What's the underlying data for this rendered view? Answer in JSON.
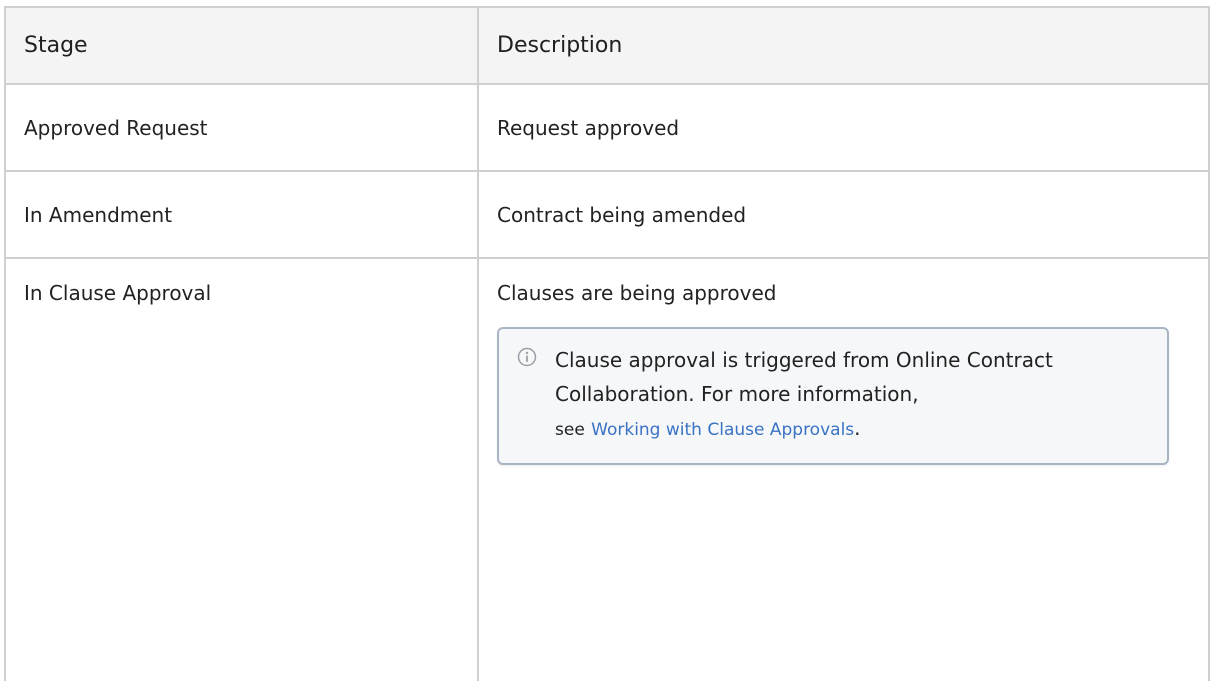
{
  "table": {
    "headers": {
      "stage": "Stage",
      "description": "Description"
    },
    "rows": [
      {
        "stage": "Approved Request",
        "description": "Request approved"
      },
      {
        "stage": "In Amendment",
        "description": "Contract being amended"
      },
      {
        "stage": "In Clause Approval",
        "description": "Clauses are being approved"
      }
    ]
  },
  "info_panel": {
    "icon": "info-icon",
    "text": "Clause approval is triggered from Online Contract Collaboration. For more information,",
    "see_label": "see",
    "link_text": "Working with Clause Approvals",
    "trailing": "."
  },
  "colors": {
    "border": "#cfcfcf",
    "header_bg": "#f4f4f4",
    "panel_border": "#a8b4c3",
    "panel_bg": "#f5f7f9",
    "link": "#3a72c4"
  }
}
